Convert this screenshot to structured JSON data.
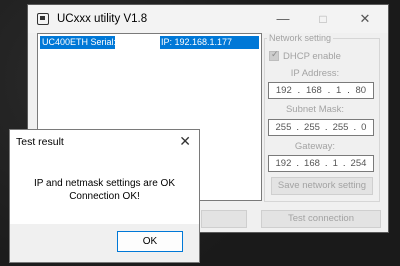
{
  "app": {
    "title": "UCxxx utility   V1.8",
    "controls": {
      "minimize": "—",
      "maximize": "□",
      "close": "✕"
    }
  },
  "device_list": {
    "items": [
      {
        "serial_label": "UC400ETH Serial:",
        "ip": "IP: 192.168.1.177"
      }
    ]
  },
  "network": {
    "group_label": "Network setting",
    "dhcp_label": "DHCP enable",
    "dhcp_checked": true,
    "ip_label": "IP Address:",
    "ip": [
      "192",
      "168",
      "1",
      "80"
    ],
    "mask_label": "Subnet Mask:",
    "mask": [
      "255",
      "255",
      "255",
      "0"
    ],
    "gateway_label": "Gateway:",
    "gateway": [
      "192",
      "168",
      "1",
      "254"
    ],
    "save_label": "Save network setting",
    "test_label": "Test connection"
  },
  "dialog": {
    "title": "Test result",
    "close": "✕",
    "line1": "IP and netmask settings are OK",
    "line2": "Connection OK!",
    "ok_label": "OK"
  }
}
